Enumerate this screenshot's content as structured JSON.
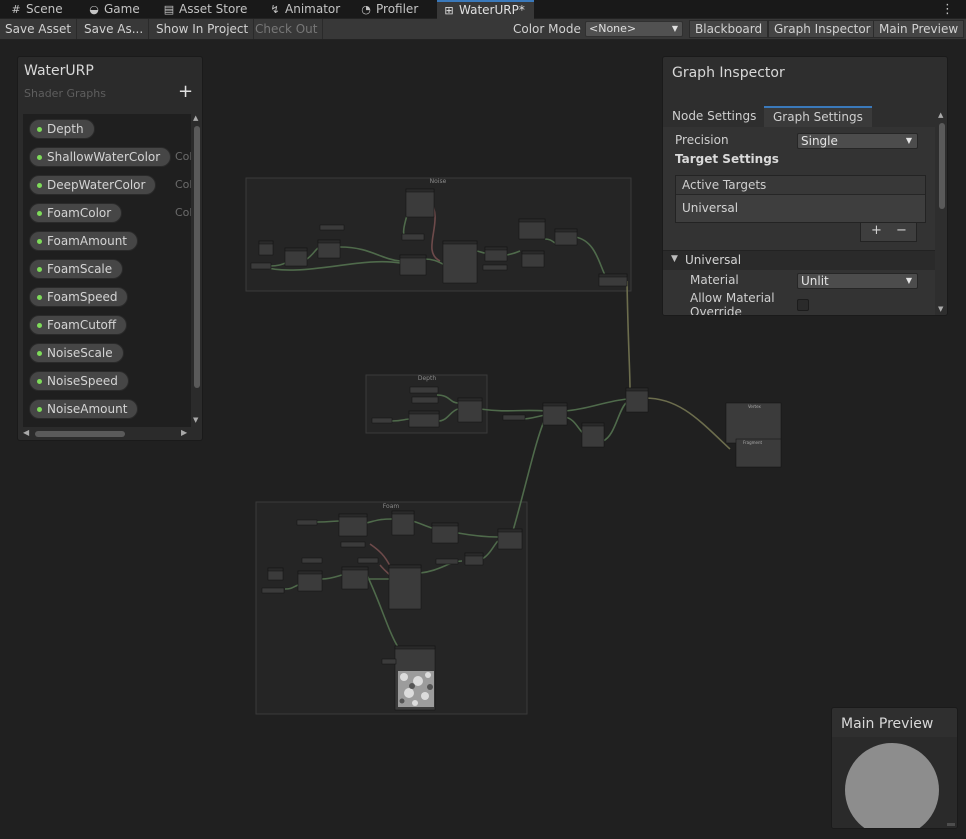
{
  "tabs": [
    {
      "label": "Scene",
      "icon": "grid-icon"
    },
    {
      "label": "Game",
      "icon": "gamepad-icon"
    },
    {
      "label": "Asset Store",
      "icon": "store-icon"
    },
    {
      "label": "Animator",
      "icon": "animator-icon"
    },
    {
      "label": "Profiler",
      "icon": "profiler-icon"
    },
    {
      "label": "WaterURP*",
      "icon": "shadergraph-icon",
      "active": true
    }
  ],
  "toolbar": {
    "save_asset": "Save Asset",
    "save_as": "Save As...",
    "show_in_project": "Show In Project",
    "check_out": "Check Out",
    "color_mode_label": "Color Mode",
    "color_mode_value": "<None>",
    "blackboard": "Blackboard",
    "graph_inspector": "Graph Inspector",
    "main_preview": "Main Preview"
  },
  "blackboard": {
    "title": "WaterURP",
    "subtitle": "Shader Graphs",
    "properties": [
      {
        "name": "Depth",
        "type": ""
      },
      {
        "name": "ShallowWaterColor",
        "type": "Col"
      },
      {
        "name": "DeepWaterColor",
        "type": "Col"
      },
      {
        "name": "FoamColor",
        "type": "Col"
      },
      {
        "name": "FoamAmount",
        "type": ""
      },
      {
        "name": "FoamScale",
        "type": ""
      },
      {
        "name": "FoamSpeed",
        "type": ""
      },
      {
        "name": "FoamCutoff",
        "type": ""
      },
      {
        "name": "NoiseScale",
        "type": ""
      },
      {
        "name": "NoiseSpeed",
        "type": ""
      },
      {
        "name": "NoiseAmount",
        "type": ""
      }
    ]
  },
  "inspector": {
    "title": "Graph Inspector",
    "tab_node": "Node Settings",
    "tab_graph": "Graph Settings",
    "precision_label": "Precision",
    "precision_value": "Single",
    "target_settings": "Target Settings",
    "active_targets": "Active Targets",
    "target_item": "Universal",
    "add": "+",
    "remove": "−",
    "section": "Universal",
    "material_label": "Material",
    "material_value": "Unlit",
    "allow_override_1": "Allow Material",
    "allow_override_2": "Override",
    "allow_override_checked": false
  },
  "groups": {
    "noise": "Noise",
    "depth": "Depth",
    "foam": "Foam",
    "master": "Vertex",
    "master_fragment": "Fragment"
  },
  "preview": {
    "title": "Main Preview"
  },
  "colors": {
    "accent": "#3a79bb",
    "property_dot": "#7edb5a",
    "edge": "#4f6a4b",
    "edge_highlight": "#6c6d4d"
  }
}
